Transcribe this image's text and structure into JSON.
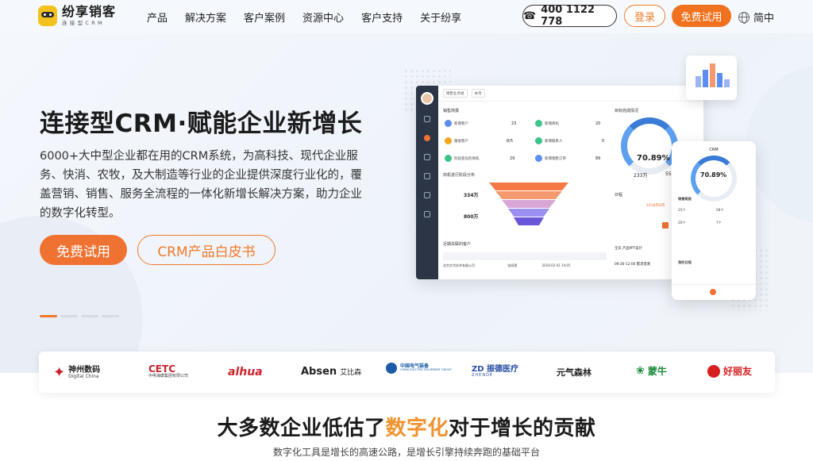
{
  "brand": {
    "name": "纷享销客",
    "tagline": "连接型CRM"
  },
  "nav": {
    "items": [
      "产品",
      "解决方案",
      "客户案例",
      "资源中心",
      "客户支持",
      "关于纷享"
    ]
  },
  "header": {
    "phone": "400 1122 778",
    "login": "登录",
    "trial": "免费试用",
    "lang": "简中"
  },
  "hero": {
    "title": "连接型CRM·赋能企业新增长",
    "desc": "6000+大中型企业都在用的CRM系统，为高科技、现代企业服务、快消、农牧，及大制造等行业的企业提供深度行业化的，覆盖营销、销售、服务全流程的一体化新增长解决方案，助力企业的数字化转型。",
    "btn_trial": "免费试用",
    "btn_whitepaper": "CRM产品白皮书",
    "slide_total": 4,
    "slide_active": 1
  },
  "dashboard": {
    "filter1": "销售业务组",
    "filter2": "本月",
    "brief_title": "销售简报",
    "stats": [
      {
        "label": "新增客户",
        "value": "23"
      },
      {
        "label": "新增商机",
        "value": "20"
      },
      {
        "label": "跟进客户",
        "value": "8/5"
      },
      {
        "label": "新增联系人",
        "value": "0"
      },
      {
        "label": "阶段变化的商机",
        "value": "29"
      },
      {
        "label": "新增销售订单",
        "value": "89"
      }
    ],
    "goal_title": "目标完成情况",
    "goal_percent": "70.89%",
    "goal_a": "233万",
    "goal_b": "55",
    "funnel_title": "商机进行阶段分布",
    "funnel_v1": "334万",
    "funnel_v2": "800万",
    "schedule_title": "日程",
    "schedule_date": "2018年8月",
    "schedule_items": [
      "全天 产品PPT设计",
      "09:30-12:00 需求澄清"
    ],
    "recent_title": "近期关联的客户",
    "recent_row": {
      "name": "北京文华技术有限公司",
      "owner": "张经理",
      "date": "2016-02-01 14:05"
    }
  },
  "phone_card": {
    "title": "CRM",
    "percent": "70.89%",
    "brief": "销售简报",
    "sched": "我的日程",
    "row1": "25个",
    "row2": "58个",
    "row3": "20个",
    "row4": "7个"
  },
  "logos": [
    {
      "main": "神州数码",
      "sub": "Digital China",
      "color": "#c8232c"
    },
    {
      "main": "CETC",
      "sub": "中电海康集团有限公司",
      "color": "#c8232c"
    },
    {
      "main": "alhua",
      "sub": "",
      "color": "#c8232c"
    },
    {
      "main": "Absen",
      "sub": "艾比森",
      "color": "#222222"
    },
    {
      "main": "中国电气装备",
      "sub": "CHINA ELECTRIC EQUIPMENT GROUP",
      "color": "#1a5ca8"
    },
    {
      "main": "ZD 振德医疗",
      "sub": "ZHENDE",
      "color": "#2c4fa3"
    },
    {
      "main": "元气森林",
      "sub": "",
      "color": "#222222"
    },
    {
      "main": "蒙牛",
      "sub": "",
      "color": "#1a8a3a"
    },
    {
      "main": "好丽友",
      "sub": "",
      "color": "#d62020"
    }
  ],
  "section": {
    "title_pre": "大多数企业低估了",
    "title_hl": "数字化",
    "title_post": "对于增长的贡献",
    "subtitle": "数字化工具是增长的高速公路，是增长引擎持续奔跑的基础平台"
  },
  "colors": {
    "accent": "#f07232",
    "highlight": "#f0922e",
    "sidebar": "#2b3545"
  }
}
